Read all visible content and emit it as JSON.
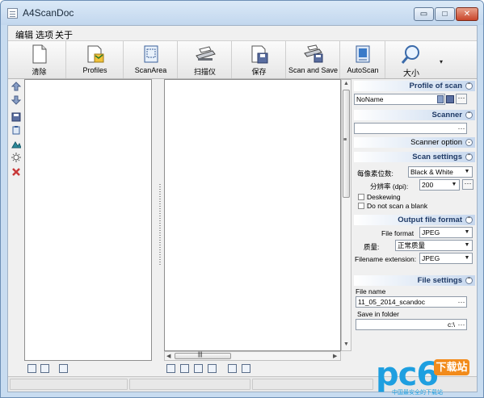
{
  "window": {
    "title": "A4ScanDoc",
    "min_glyph": "▭",
    "max_glyph": "□",
    "close_glyph": "✕"
  },
  "menu": [
    "编辑",
    "选项",
    "关于"
  ],
  "toolbar": {
    "buttons": [
      {
        "label": "清除",
        "icon": "page-icon"
      },
      {
        "label": "Profiles",
        "icon": "profiles-icon"
      },
      {
        "label": "ScanArea",
        "icon": "scan-area-icon"
      },
      {
        "label": "扫描仪",
        "icon": "scanner-icon"
      },
      {
        "label": "保存",
        "icon": "save-icon"
      },
      {
        "label": "Scan and Save",
        "icon": "scan-and-save-icon"
      },
      {
        "label": "AutoScan",
        "icon": "autoscan-icon"
      },
      {
        "label": "大小",
        "icon": "zoom-icon"
      }
    ],
    "more_glyph": "▾"
  },
  "left_tools": [
    "arrow-up-icon",
    "arrow-down-icon",
    "save-icon",
    "clipboard-icon",
    "image-icon",
    "brightness-icon",
    "delete-icon"
  ],
  "scroll": {
    "hthumb_grip": "|||",
    "vthumb_grip": "≡"
  },
  "right": {
    "profile": {
      "header": "Profile of scan",
      "value": "NoName",
      "dots": "···"
    },
    "scanner": {
      "header": "Scanner",
      "value": "",
      "dots": "···",
      "option_label": "Scanner option"
    },
    "scan_settings": {
      "header": "Scan settings",
      "bpp_label": "每像素位数:",
      "bpp_value": "Black & White",
      "dpi_label": "分辨率 (dpi):",
      "dpi_value": "200",
      "deskew_label": "Deskewing",
      "blank_label": "Do not scan a blank",
      "deskew_checked": false,
      "blank_checked": false
    },
    "output": {
      "header": "Output file format",
      "format_label": "File format",
      "format_value": "JPEG",
      "quality_label": "质量:",
      "quality_value": "正常质量",
      "ext_label": "Filename extension:",
      "ext_value": "JPEG"
    },
    "file": {
      "header": "File settings",
      "name_label": "File name",
      "name_value": "11_05_2014_scandoc",
      "folder_label": "Save in  folder",
      "folder_value": "c:\\",
      "dots": "···"
    }
  },
  "watermark": {
    "logo": "pc6",
    "badge": "下载站",
    "tagline": "中国最安全的下载站"
  }
}
